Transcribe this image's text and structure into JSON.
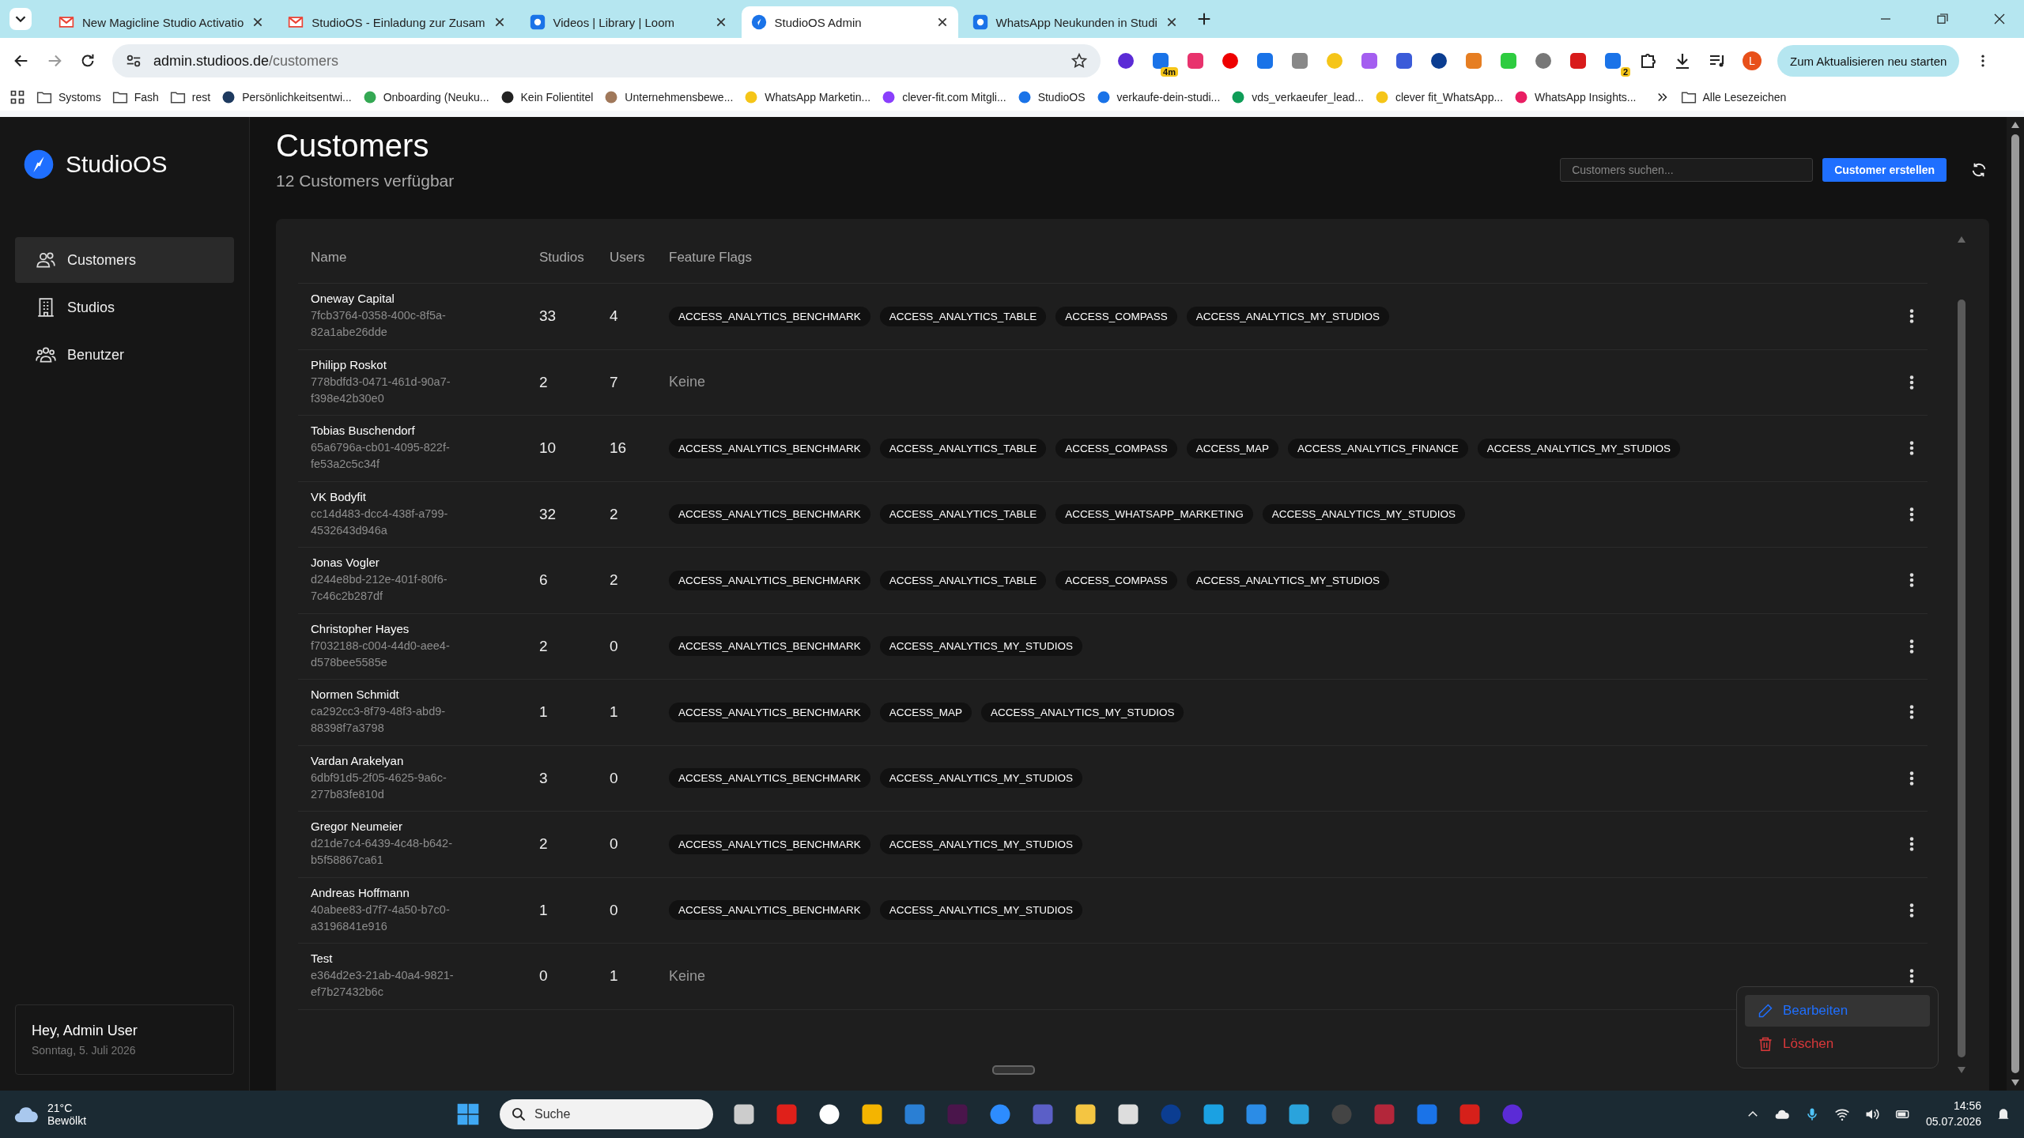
{
  "browser": {
    "tabs": [
      {
        "title": "New Magicline Studio Activatio",
        "selected": false
      },
      {
        "title": "StudioOS - Einladung zur Zusam",
        "selected": false
      },
      {
        "title": "Videos | Library | Loom",
        "selected": false
      },
      {
        "title": "StudioOS Admin",
        "selected": true
      },
      {
        "title": "WhatsApp Neukunden in Studi",
        "selected": false
      }
    ],
    "address": {
      "host": "admin.studioos.de",
      "path": "/customers"
    },
    "extensions": [
      {
        "badge": "4m"
      },
      {
        "badge": "2"
      }
    ],
    "profile": "L",
    "update_button": "Zum Aktualisieren neu starten",
    "bookmarks": [
      {
        "label": "Systoms",
        "kind": "folder"
      },
      {
        "label": "Fash",
        "kind": "folder"
      },
      {
        "label": "rest",
        "kind": "folder"
      },
      {
        "label": "Persönlichkeitsentwi...",
        "kind": "site"
      },
      {
        "label": "Onboarding (Neuku...",
        "kind": "site"
      },
      {
        "label": "Kein Folientitel",
        "kind": "site"
      },
      {
        "label": "Unternehmensbewe...",
        "kind": "site"
      },
      {
        "label": "WhatsApp Marketin...",
        "kind": "site"
      },
      {
        "label": "clever-fit.com Mitgli...",
        "kind": "site"
      },
      {
        "label": "StudioOS",
        "kind": "site"
      },
      {
        "label": "verkaufe-dein-studi...",
        "kind": "site"
      },
      {
        "label": "vds_verkaeufer_lead...",
        "kind": "site"
      },
      {
        "label": "clever fit_WhatsApp...",
        "kind": "site"
      },
      {
        "label": "WhatsApp Insights...",
        "kind": "site"
      }
    ],
    "all_bookmarks": "Alle Lesezeichen"
  },
  "sidebar": {
    "brand": "StudioOS",
    "items": [
      {
        "label": "Customers",
        "selected": true
      },
      {
        "label": "Studios",
        "selected": false
      },
      {
        "label": "Benutzer",
        "selected": false
      }
    ],
    "greeting": "Hey, Admin User",
    "date": "Sonntag, 5. Juli 2026"
  },
  "header": {
    "title": "Customers",
    "subtitle": "12 Customers verfügbar",
    "search": {
      "placeholder": "Customers suchen..."
    },
    "create_button": "Customer erstellen"
  },
  "table": {
    "columns": [
      "Name",
      "Studios",
      "Users",
      "Feature Flags"
    ],
    "rows": [
      {
        "name": "Oneway Capital",
        "id": "7fcb3764-0358-400c-8f5a-82a1abe26dde",
        "studios": "33",
        "users": "4",
        "flags": [
          "ACCESS_ANALYTICS_BENCHMARK",
          "ACCESS_ANALYTICS_TABLE",
          "ACCESS_COMPASS",
          "ACCESS_ANALYTICS_MY_STUDIOS"
        ]
      },
      {
        "name": "Philipp Roskot",
        "id": "778bdfd3-0471-461d-90a7-f398e42b30e0",
        "studios": "2",
        "users": "7",
        "no_flags": "Keine"
      },
      {
        "name": "Tobias Buschendorf",
        "id": "65a6796a-cb01-4095-822f-fe53a2c5c34f",
        "studios": "10",
        "users": "16",
        "flags": [
          "ACCESS_ANALYTICS_BENCHMARK",
          "ACCESS_ANALYTICS_TABLE",
          "ACCESS_COMPASS",
          "ACCESS_MAP",
          "ACCESS_ANALYTICS_FINANCE",
          "ACCESS_ANALYTICS_MY_STUDIOS"
        ]
      },
      {
        "name": "VK Bodyfit",
        "id": "cc14d483-dcc4-438f-a799-4532643d946a",
        "studios": "32",
        "users": "2",
        "flags": [
          "ACCESS_ANALYTICS_BENCHMARK",
          "ACCESS_ANALYTICS_TABLE",
          "ACCESS_WHATSAPP_MARKETING",
          "ACCESS_ANALYTICS_MY_STUDIOS"
        ]
      },
      {
        "name": "Jonas Vogler",
        "id": "d244e8bd-212e-401f-80f6-7c46c2b287df",
        "studios": "6",
        "users": "2",
        "flags": [
          "ACCESS_ANALYTICS_BENCHMARK",
          "ACCESS_ANALYTICS_TABLE",
          "ACCESS_COMPASS",
          "ACCESS_ANALYTICS_MY_STUDIOS"
        ]
      },
      {
        "name": "Christopher Hayes",
        "id": "f7032188-c004-44d0-aee4-d578bee5585e",
        "studios": "2",
        "users": "0",
        "flags": [
          "ACCESS_ANALYTICS_BENCHMARK",
          "ACCESS_ANALYTICS_MY_STUDIOS"
        ]
      },
      {
        "name": "Normen Schmidt",
        "id": "ca292cc3-8f79-48f3-abd9-88398f7a3798",
        "studios": "1",
        "users": "1",
        "flags": [
          "ACCESS_ANALYTICS_BENCHMARK",
          "ACCESS_MAP",
          "ACCESS_ANALYTICS_MY_STUDIOS"
        ]
      },
      {
        "name": "Vardan Arakelyan",
        "id": "6dbf91d5-2f05-4625-9a6c-277b83fe810d",
        "studios": "3",
        "users": "0",
        "flags": [
          "ACCESS_ANALYTICS_BENCHMARK",
          "ACCESS_ANALYTICS_MY_STUDIOS"
        ]
      },
      {
        "name": "Gregor Neumeier",
        "id": "d21de7c4-6439-4c48-b642-b5f58867ca61",
        "studios": "2",
        "users": "0",
        "flags": [
          "ACCESS_ANALYTICS_BENCHMARK",
          "ACCESS_ANALYTICS_MY_STUDIOS"
        ]
      },
      {
        "name": "Andreas Hoffmann",
        "id": "40abee83-d7f7-4a50-b7c0-a3196841e916",
        "studios": "1",
        "users": "0",
        "flags": [
          "ACCESS_ANALYTICS_BENCHMARK",
          "ACCESS_ANALYTICS_MY_STUDIOS"
        ]
      },
      {
        "name": "Test",
        "id": "e364d2e3-21ab-40a4-9821-ef7b27432b6c",
        "studios": "0",
        "users": "1",
        "no_flags": "Keine"
      }
    ],
    "row_menu": [
      {
        "label": "Bearbeiten",
        "kind": "edit",
        "selected": true
      },
      {
        "label": "Löschen",
        "kind": "delete",
        "selected": false
      }
    ]
  },
  "taskbar": {
    "temperature": "21°C",
    "weather": "Bewölkt",
    "search": {
      "placeholder": "Suche"
    },
    "time": "14:56",
    "date": "05.07.2026"
  }
}
